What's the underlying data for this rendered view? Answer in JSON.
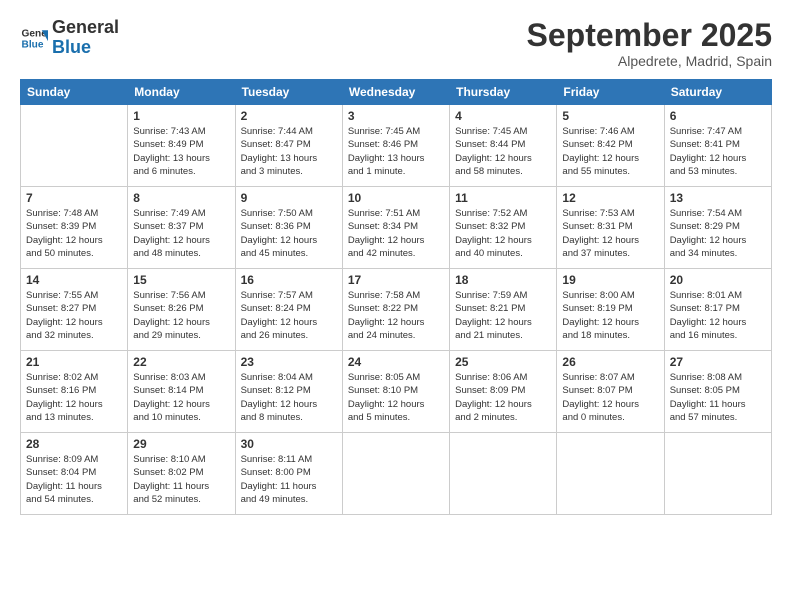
{
  "logo": {
    "general": "General",
    "blue": "Blue"
  },
  "header": {
    "month": "September 2025",
    "location": "Alpedrete, Madrid, Spain"
  },
  "days_of_week": [
    "Sunday",
    "Monday",
    "Tuesday",
    "Wednesday",
    "Thursday",
    "Friday",
    "Saturday"
  ],
  "weeks": [
    [
      {
        "day": "",
        "info": ""
      },
      {
        "day": "1",
        "info": "Sunrise: 7:43 AM\nSunset: 8:49 PM\nDaylight: 13 hours\nand 6 minutes."
      },
      {
        "day": "2",
        "info": "Sunrise: 7:44 AM\nSunset: 8:47 PM\nDaylight: 13 hours\nand 3 minutes."
      },
      {
        "day": "3",
        "info": "Sunrise: 7:45 AM\nSunset: 8:46 PM\nDaylight: 13 hours\nand 1 minute."
      },
      {
        "day": "4",
        "info": "Sunrise: 7:45 AM\nSunset: 8:44 PM\nDaylight: 12 hours\nand 58 minutes."
      },
      {
        "day": "5",
        "info": "Sunrise: 7:46 AM\nSunset: 8:42 PM\nDaylight: 12 hours\nand 55 minutes."
      },
      {
        "day": "6",
        "info": "Sunrise: 7:47 AM\nSunset: 8:41 PM\nDaylight: 12 hours\nand 53 minutes."
      }
    ],
    [
      {
        "day": "7",
        "info": "Sunrise: 7:48 AM\nSunset: 8:39 PM\nDaylight: 12 hours\nand 50 minutes."
      },
      {
        "day": "8",
        "info": "Sunrise: 7:49 AM\nSunset: 8:37 PM\nDaylight: 12 hours\nand 48 minutes."
      },
      {
        "day": "9",
        "info": "Sunrise: 7:50 AM\nSunset: 8:36 PM\nDaylight: 12 hours\nand 45 minutes."
      },
      {
        "day": "10",
        "info": "Sunrise: 7:51 AM\nSunset: 8:34 PM\nDaylight: 12 hours\nand 42 minutes."
      },
      {
        "day": "11",
        "info": "Sunrise: 7:52 AM\nSunset: 8:32 PM\nDaylight: 12 hours\nand 40 minutes."
      },
      {
        "day": "12",
        "info": "Sunrise: 7:53 AM\nSunset: 8:31 PM\nDaylight: 12 hours\nand 37 minutes."
      },
      {
        "day": "13",
        "info": "Sunrise: 7:54 AM\nSunset: 8:29 PM\nDaylight: 12 hours\nand 34 minutes."
      }
    ],
    [
      {
        "day": "14",
        "info": "Sunrise: 7:55 AM\nSunset: 8:27 PM\nDaylight: 12 hours\nand 32 minutes."
      },
      {
        "day": "15",
        "info": "Sunrise: 7:56 AM\nSunset: 8:26 PM\nDaylight: 12 hours\nand 29 minutes."
      },
      {
        "day": "16",
        "info": "Sunrise: 7:57 AM\nSunset: 8:24 PM\nDaylight: 12 hours\nand 26 minutes."
      },
      {
        "day": "17",
        "info": "Sunrise: 7:58 AM\nSunset: 8:22 PM\nDaylight: 12 hours\nand 24 minutes."
      },
      {
        "day": "18",
        "info": "Sunrise: 7:59 AM\nSunset: 8:21 PM\nDaylight: 12 hours\nand 21 minutes."
      },
      {
        "day": "19",
        "info": "Sunrise: 8:00 AM\nSunset: 8:19 PM\nDaylight: 12 hours\nand 18 minutes."
      },
      {
        "day": "20",
        "info": "Sunrise: 8:01 AM\nSunset: 8:17 PM\nDaylight: 12 hours\nand 16 minutes."
      }
    ],
    [
      {
        "day": "21",
        "info": "Sunrise: 8:02 AM\nSunset: 8:16 PM\nDaylight: 12 hours\nand 13 minutes."
      },
      {
        "day": "22",
        "info": "Sunrise: 8:03 AM\nSunset: 8:14 PM\nDaylight: 12 hours\nand 10 minutes."
      },
      {
        "day": "23",
        "info": "Sunrise: 8:04 AM\nSunset: 8:12 PM\nDaylight: 12 hours\nand 8 minutes."
      },
      {
        "day": "24",
        "info": "Sunrise: 8:05 AM\nSunset: 8:10 PM\nDaylight: 12 hours\nand 5 minutes."
      },
      {
        "day": "25",
        "info": "Sunrise: 8:06 AM\nSunset: 8:09 PM\nDaylight: 12 hours\nand 2 minutes."
      },
      {
        "day": "26",
        "info": "Sunrise: 8:07 AM\nSunset: 8:07 PM\nDaylight: 12 hours\nand 0 minutes."
      },
      {
        "day": "27",
        "info": "Sunrise: 8:08 AM\nSunset: 8:05 PM\nDaylight: 11 hours\nand 57 minutes."
      }
    ],
    [
      {
        "day": "28",
        "info": "Sunrise: 8:09 AM\nSunset: 8:04 PM\nDaylight: 11 hours\nand 54 minutes."
      },
      {
        "day": "29",
        "info": "Sunrise: 8:10 AM\nSunset: 8:02 PM\nDaylight: 11 hours\nand 52 minutes."
      },
      {
        "day": "30",
        "info": "Sunrise: 8:11 AM\nSunset: 8:00 PM\nDaylight: 11 hours\nand 49 minutes."
      },
      {
        "day": "",
        "info": ""
      },
      {
        "day": "",
        "info": ""
      },
      {
        "day": "",
        "info": ""
      },
      {
        "day": "",
        "info": ""
      }
    ]
  ]
}
